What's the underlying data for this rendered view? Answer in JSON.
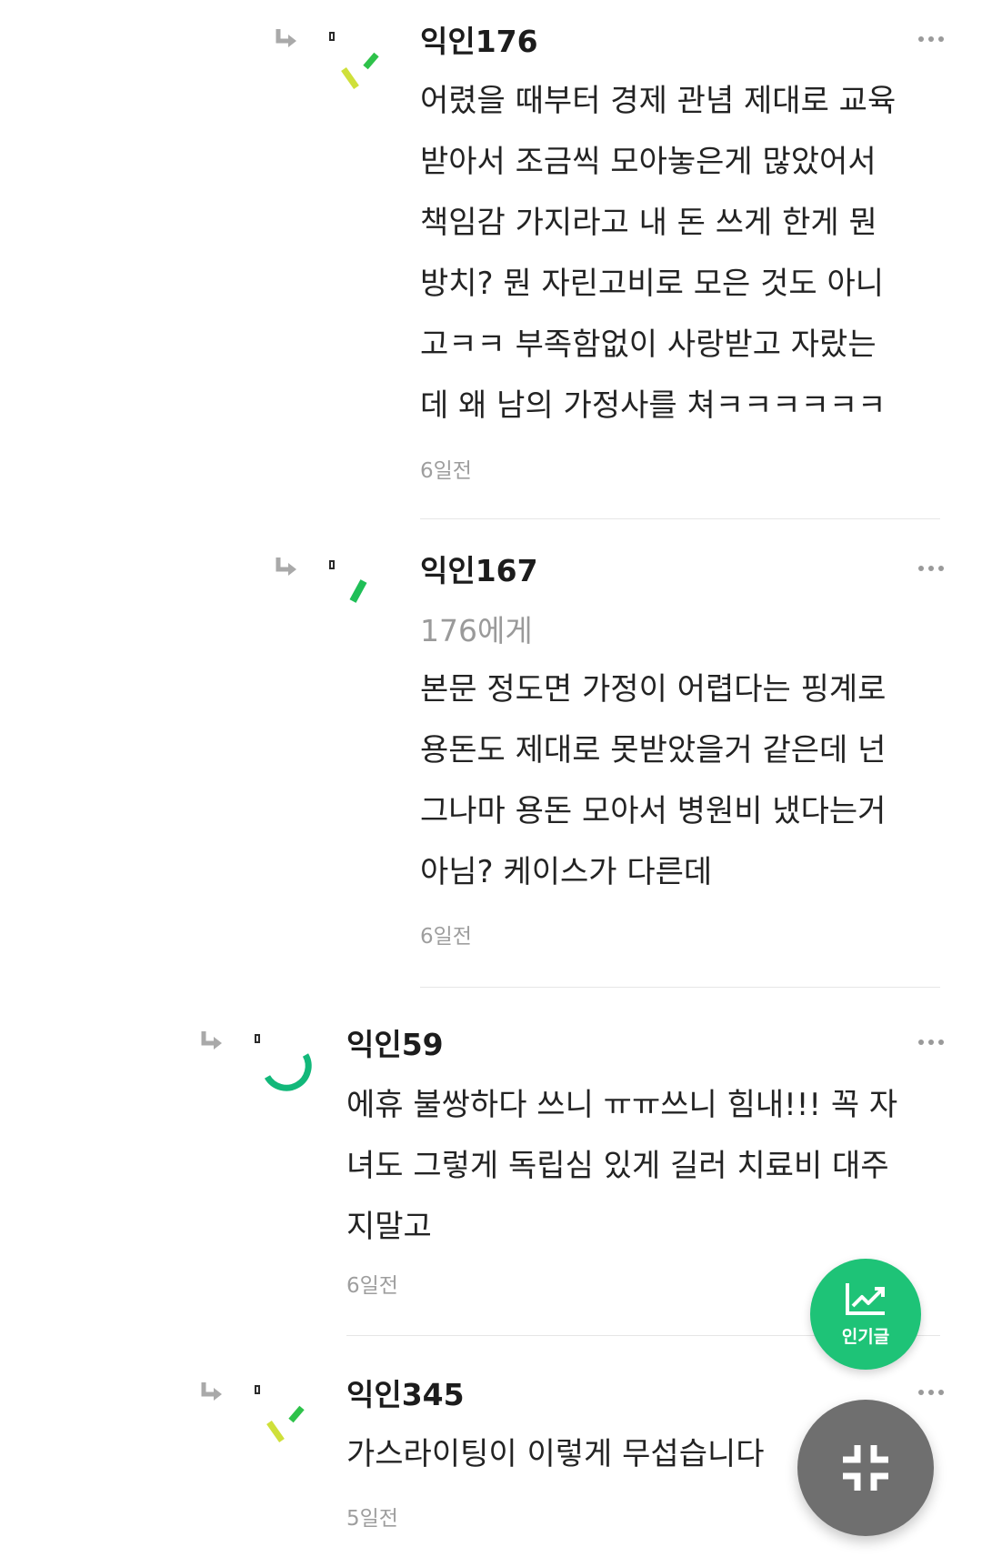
{
  "comments": [
    {
      "author": "익인176",
      "target": "",
      "lines": [
        "어렸을 때부터 경제 관념 제대로 교육",
        "받아서 조금씩 모아놓은게 많았어서",
        "책임감 가지라고 내 돈 쓰게 한게 뭔",
        "방치? 뭔 자린고비로 모은 것도 아니",
        "고ㅋㅋ 부족함없이 사랑받고 자랐는",
        "데 왜 남의 가정사를 쳐ㅋㅋㅋㅋㅋㅋ"
      ],
      "time": "6일전",
      "avatar_colors": [
        "#cfe03a",
        "#2ec24a"
      ]
    },
    {
      "author": "익인167",
      "target": "176에게",
      "lines": [
        "본문 정도면 가정이 어렵다는 핑계로",
        "용돈도 제대로 못받았을거 같은데 넌",
        "그나마 용돈 모아서 병원비 냈다는거",
        "아님? 케이스가 다른데"
      ],
      "time": "6일전",
      "avatar_colors": [
        "#1fbf57"
      ]
    },
    {
      "author": "익인59",
      "target": "",
      "lines": [
        "에휴 불쌍하다 쓰니 ㅠㅠ쓰니 힘내!!! 꼭 자",
        "녀도 그렇게 독립심 있게 길러 치료비 대주",
        "지말고"
      ],
      "time": "6일전",
      "avatar_colors": [
        "#12b87a"
      ]
    },
    {
      "author": "익인345",
      "target": "",
      "lines": [
        "가스라이팅이 이렇게 무섭습니다"
      ],
      "time": "5일전",
      "avatar_colors": [
        "#cfe03a",
        "#2ec24a"
      ]
    }
  ],
  "fab": {
    "popular_label": "인기글",
    "popular_icon": "trending-chart-icon",
    "collapse_icon": "collapse-arrows-icon",
    "popular_color": "#1ec377",
    "collapse_color": "#6f6f6f"
  }
}
